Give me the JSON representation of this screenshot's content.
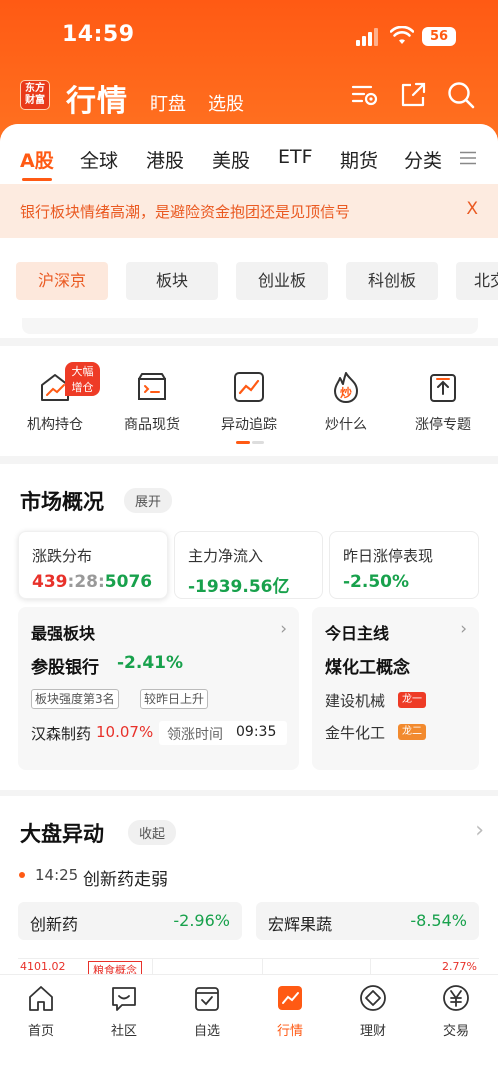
{
  "status": {
    "time": "14:59",
    "battery": "56"
  },
  "header": {
    "logo": "东方财富",
    "title": "行情",
    "sub_tabs": [
      "盯盘",
      "选股"
    ]
  },
  "tabs": [
    "A股",
    "全球",
    "港股",
    "美股",
    "ETF",
    "期货",
    "分类"
  ],
  "notice": {
    "text": "银行板块情绪高潮，是避险资金抱团还是见顶信号",
    "close": "X"
  },
  "markets": [
    "沪深京",
    "板块",
    "创业板",
    "科创板",
    "北交"
  ],
  "shortcuts": [
    {
      "label": "机构持仓",
      "badge": "大幅增仓"
    },
    {
      "label": "商品现货"
    },
    {
      "label": "异动追踪"
    },
    {
      "label": "炒什么",
      "icon_text": "炒"
    },
    {
      "label": "涨停专题"
    }
  ],
  "overview": {
    "title": "市场概况",
    "toggle": "展开",
    "cards": [
      {
        "title": "涨跌分布",
        "up": "439",
        "sep1": ":",
        "flat": "28",
        "sep2": ":",
        "down": "5076"
      },
      {
        "title": "主力净流入",
        "value": "-1939.56亿"
      },
      {
        "title": "昨日涨停表现",
        "value": "-2.50%"
      }
    ],
    "strongest": {
      "title": "最强板块",
      "sector": "参股银行",
      "change": "-2.41%",
      "tags": [
        "板块强度第3名",
        "较昨日上升"
      ],
      "stock": "汉森制药",
      "stock_change": "10.07%",
      "limit_label": "领涨时间",
      "limit_time": "09:35"
    },
    "mainline": {
      "title": "今日主线",
      "theme": "煤化工概念",
      "items": [
        {
          "name": "建设机械",
          "tag": "龙一"
        },
        {
          "name": "金牛化工",
          "tag": "龙二"
        }
      ]
    }
  },
  "movement": {
    "title": "大盘异动",
    "toggle": "收起",
    "event_time": "14:25",
    "event_text": "创新药走弱",
    "items": [
      {
        "name": "创新药",
        "value": "-2.96%"
      },
      {
        "name": "宏辉果蔬",
        "value": "-8.54%"
      }
    ],
    "chart_left_value": "4101.02",
    "chart_tag": "粮食概念",
    "chart_right_value": "2.77%"
  },
  "nav": [
    "首页",
    "社区",
    "自选",
    "行情",
    "理财",
    "交易"
  ],
  "colors": {
    "brand": "#ff5a14",
    "up": "#e8312a",
    "down": "#18a14c"
  }
}
